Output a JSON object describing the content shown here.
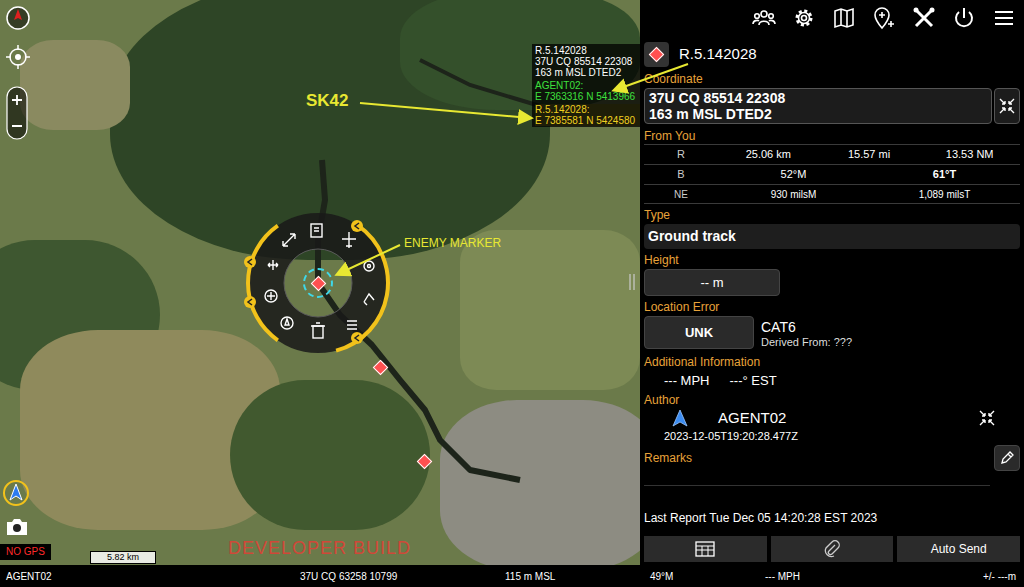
{
  "map": {
    "callout": {
      "lines": [
        {
          "text": "R.5.142028",
          "color": "#ffffff"
        },
        {
          "text": "37U CQ 85514 22308",
          "color": "#ffffff"
        },
        {
          "text": "163 m MSL DTED2",
          "color": "#ffffff"
        },
        {
          "text": "AGENT02:",
          "color": "#3ee03e"
        },
        {
          "text": "E 7363316 N 5413966",
          "color": "#3ee03e"
        },
        {
          "text": "R.5.142028:",
          "color": "#f0d020"
        },
        {
          "text": "E 7385581 N 5424580",
          "color": "#f0d020"
        }
      ]
    },
    "annotations": {
      "sk42": "SK42",
      "enemy": "ENEMY MARKER"
    },
    "markers": [
      {
        "selected": true
      },
      {
        "selected": false
      },
      {
        "selected": false
      }
    ],
    "scale": "5.82 km",
    "gps_status": "NO GPS",
    "watermark": "DEVELOPER BUILD"
  },
  "details": {
    "title": "R.5.142028",
    "coordinate_label": "Coordinate",
    "coordinate": [
      "37U CQ 85514 22308",
      "163 m MSL DTED2"
    ],
    "from_you": {
      "label": "From You",
      "rows": [
        {
          "label": "R",
          "values": [
            "25.06 km",
            "15.57 mi",
            "13.53 NM"
          ]
        },
        {
          "label": "B",
          "values": [
            "52°M",
            "61°T"
          ]
        },
        {
          "label": "NE",
          "values": [
            "930 milsM",
            "1,089 milsT"
          ]
        }
      ]
    },
    "type_label": "Type",
    "type": "Ground track",
    "height_label": "Height",
    "height": "-- m",
    "location_error_label": "Location Error",
    "location_error": "UNK",
    "category": "CAT6",
    "derived_from": "Derived From: ???",
    "additional_label": "Additional Information",
    "speed": "--- MPH",
    "course": "---° EST",
    "author_label": "Author",
    "author": "AGENT02",
    "timestamp": "2023-12-05T19:20:28.477Z",
    "remarks_label": "Remarks",
    "last_report": "Last Report Tue Dec 05 14:20:28 EST 2023",
    "send_label": "Auto Send"
  },
  "status_bar": {
    "callsign": "AGENT02",
    "grid": "37U CQ 63258 10799",
    "altitude": "115 m MSL",
    "heading": "49°M",
    "speed": "--- MPH",
    "error": "+/- ---m"
  }
}
